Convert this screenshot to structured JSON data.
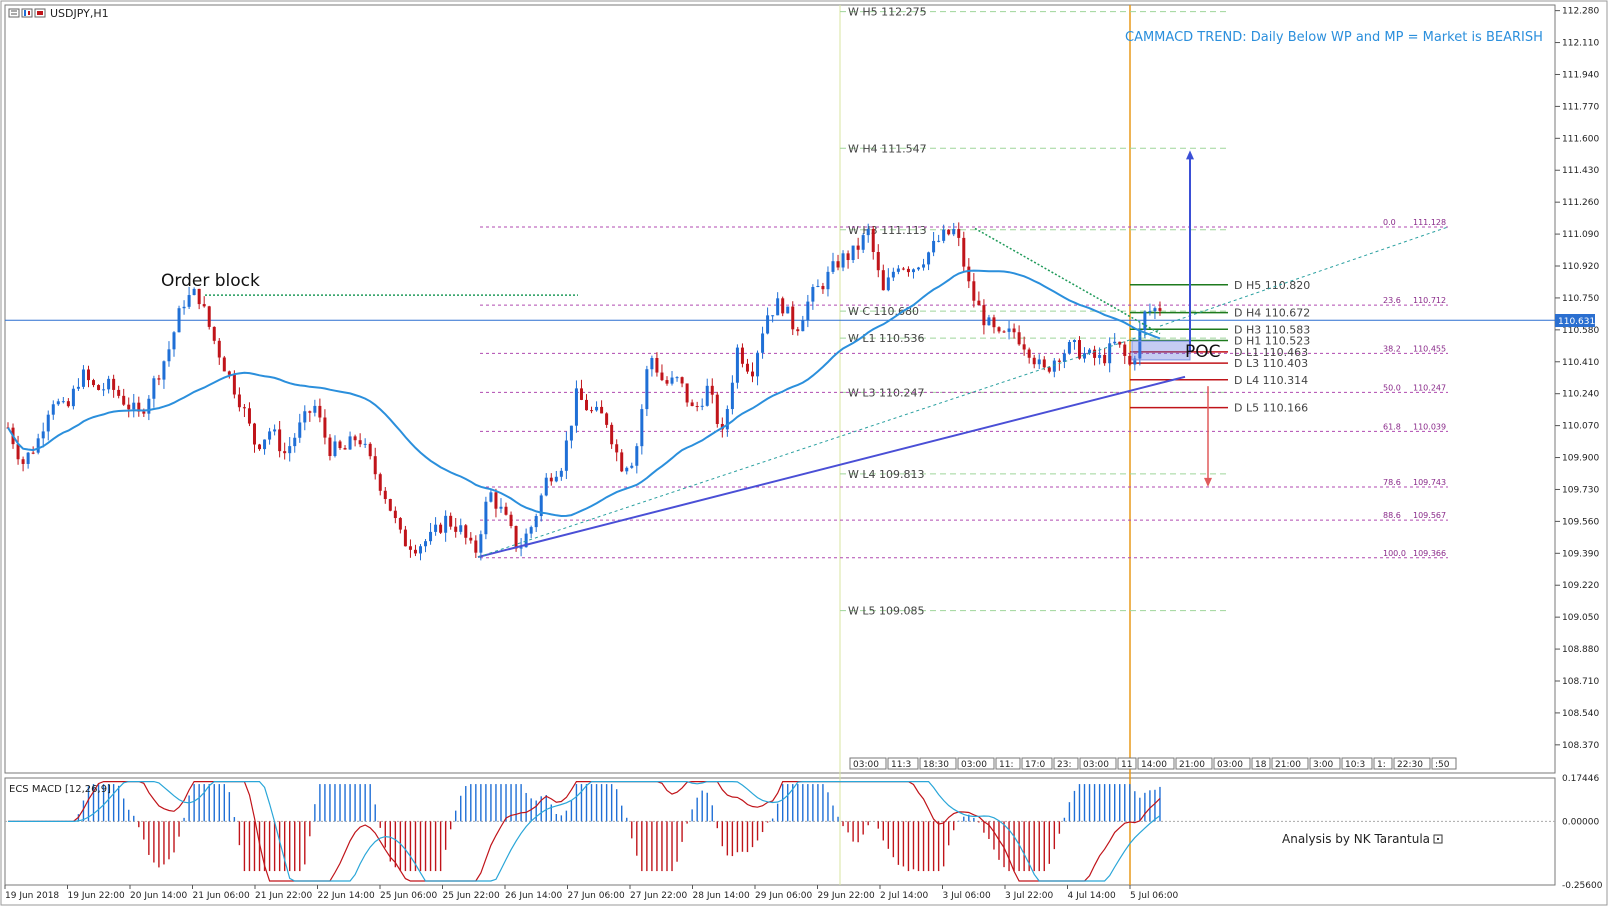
{
  "window": {
    "symbol_label": "USDJPY,H1",
    "current_price": "110.631"
  },
  "annotations": {
    "order_block": "Order block",
    "trend_banner": "CAMMACD TREND: Daily Below WP and MP = Market is BEARISH",
    "poc": "POC",
    "credit": "Analysis by NK Tarantula"
  },
  "indicator_label": "ECS MACD [12,26,9]",
  "chart_data": [
    {
      "type": "line",
      "symbol": "USDJPY",
      "timeframe": "H1",
      "y_ticks": [
        112.28,
        112.11,
        111.94,
        111.77,
        111.6,
        111.43,
        111.26,
        111.09,
        110.92,
        110.75,
        110.58,
        110.41,
        110.24,
        110.07,
        109.9,
        109.73,
        109.56,
        109.39,
        109.22,
        109.05,
        108.88,
        108.71,
        108.54,
        108.37
      ],
      "y_tick_labels": [
        "112.280",
        "112.110",
        "111.940",
        "111.770",
        "111.600",
        "111.430",
        "111.260",
        "111.090",
        "110.920",
        "110.750",
        "110.580",
        "110.410",
        "110.240",
        "110.070",
        "109.900",
        "109.730",
        "109.560",
        "109.390",
        "109.220",
        "109.050",
        "108.880",
        "108.710",
        "108.540",
        "108.370"
      ],
      "ylim": [
        108.22,
        112.31
      ],
      "x_tick_labels": [
        "19 Jun 2018",
        "19 Jun 22:00",
        "20 Jun 14:00",
        "21 Jun 06:00",
        "21 Jun 22:00",
        "22 Jun 14:00",
        "25 Jun 06:00",
        "25 Jun 22:00",
        "26 Jun 14:00",
        "27 Jun 06:00",
        "27 Jun 22:00",
        "28 Jun 14:00",
        "29 Jun 06:00",
        "29 Jun 22:00",
        "2 Jul 14:00",
        "3 Jul 06:00",
        "3 Jul 22:00",
        "4 Jul 14:00",
        "5 Jul 06:00"
      ],
      "price_path": [
        110.06,
        109.87,
        109.98,
        110.22,
        110.14,
        110.35,
        110.26,
        110.28,
        110.2,
        110.12,
        110.3,
        110.47,
        110.73,
        110.78,
        110.55,
        110.36,
        110.19,
        109.96,
        110.05,
        109.92,
        110.06,
        110.18,
        109.95,
        109.93,
        110.02,
        109.85,
        109.68,
        109.46,
        109.43,
        109.47,
        109.57,
        109.52,
        109.38,
        109.72,
        109.59,
        109.41,
        109.55,
        109.8,
        109.87,
        110.23,
        110.14,
        110.11,
        109.86,
        109.9,
        110.46,
        110.29,
        110.31,
        110.14,
        110.27,
        110.01,
        110.48,
        110.36,
        110.66,
        110.73,
        110.58,
        110.75,
        110.84,
        110.95,
        110.99,
        111.1,
        110.77,
        110.94,
        110.91,
        110.98,
        111.07,
        111.11,
        110.78,
        110.63,
        110.53,
        110.57,
        110.48,
        110.35,
        110.45,
        110.49,
        110.44,
        110.42,
        110.51,
        110.38,
        110.67,
        110.7
      ],
      "wp_levels": [
        {
          "label": "W  H5 112.275",
          "value": 112.275
        },
        {
          "label": "W  H4 111.547",
          "value": 111.547
        },
        {
          "label": "W  H3 111.113",
          "value": 111.113
        },
        {
          "label": "W  C 110.680",
          "value": 110.68
        },
        {
          "label": "W  L1 110.536",
          "value": 110.536
        },
        {
          "label": "W  L3 110.247",
          "value": 110.247
        },
        {
          "label": "W  L4 109.813",
          "value": 109.813
        },
        {
          "label": "W  L5 109.085",
          "value": 109.085
        }
      ],
      "daily_levels": [
        {
          "label": "D  H5 110.820",
          "value": 110.82,
          "color": "#1e7a1e"
        },
        {
          "label": "D  H4 110.672",
          "value": 110.672,
          "color": "#1e7a1e"
        },
        {
          "label": "D  H3 110.583",
          "value": 110.583,
          "color": "#1e7a1e"
        },
        {
          "label": "D  H1 110.523",
          "value": 110.523,
          "color": "#1e7a1e"
        },
        {
          "label": "D  L1 110.463",
          "value": 110.463,
          "color": "#c0141a"
        },
        {
          "label": "D  L3 110.403",
          "value": 110.403,
          "color": "#c0141a"
        },
        {
          "label": "D  L4 110.314",
          "value": 110.314,
          "color": "#c0141a"
        },
        {
          "label": "D  L5 110.166",
          "value": 110.166,
          "color": "#c0141a"
        }
      ],
      "fib_levels": [
        {
          "pct": "0.0",
          "value": 111.128
        },
        {
          "pct": "23.6",
          "value": 110.712
        },
        {
          "pct": "38.2",
          "value": 110.455
        },
        {
          "pct": "50.0",
          "value": 110.247
        },
        {
          "pct": "61.8",
          "value": 110.039
        },
        {
          "pct": "78.6",
          "value": 109.743
        },
        {
          "pct": "88.6",
          "value": 109.567
        },
        {
          "pct": "100.0",
          "value": 109.366
        }
      ],
      "time_marks": [
        "03:00",
        "11:3",
        "18:30",
        "03:00",
        "11:",
        "17:0",
        "23:",
        "03:00",
        "11",
        "14:00",
        "21:00",
        "03:00",
        "18",
        "21:00",
        "3:00",
        "10:3",
        "1:",
        "22:30",
        ":50"
      ],
      "colors": {
        "bull": "#1f6fd6",
        "bear": "#c0141a",
        "ma": "#2b8fdc",
        "trend": "#4a4fd6",
        "session": "#e89a1a"
      }
    },
    {
      "type": "bar",
      "name": "ECS MACD [12,26,9]",
      "y_tick_labels": [
        "0.17446",
        "0.00000",
        "-0.25600"
      ],
      "ylim": [
        -0.256,
        0.17446
      ]
    }
  ]
}
